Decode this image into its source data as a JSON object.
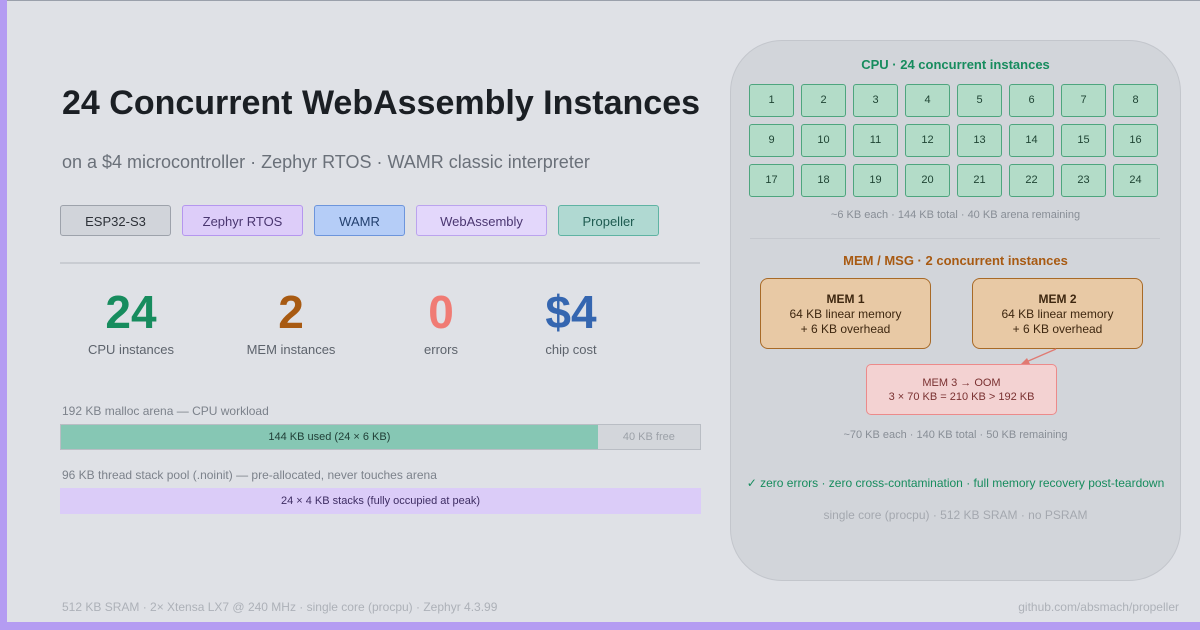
{
  "title": "24 Concurrent WebAssembly Instances",
  "subtitle": "on a $4 microcontroller · Zephyr RTOS · WAMR classic interpreter",
  "tags": [
    "ESP32-S3",
    "Zephyr RTOS",
    "WAMR",
    "WebAssembly",
    "Propeller"
  ],
  "stats": [
    {
      "value": "24",
      "label": "CPU instances",
      "color": "#178c5e"
    },
    {
      "value": "2",
      "label": "MEM instances",
      "color": "#a85a12"
    },
    {
      "value": "0",
      "label": "errors",
      "color": "#f07b74"
    },
    {
      "value": "$4",
      "label": "chip cost",
      "color": "#3566b0"
    }
  ],
  "arena": {
    "caption": "192 KB malloc arena — CPU workload",
    "used_label": "144 KB used (24 × 6 KB)",
    "free_label": "40 KB free",
    "used_fraction": 0.84
  },
  "stack_pool": {
    "caption": "96 KB thread stack pool (.noinit) — pre-allocated, never touches arena",
    "label": "24 × 4 KB stacks (fully occupied at peak)"
  },
  "footer": {
    "left": "512 KB SRAM · 2× Xtensa LX7 @ 240 MHz · single core (procpu) · Zephyr 4.3.99",
    "right": "github.com/absmach/propeller"
  },
  "panel": {
    "cpu_heading": "CPU · 24 concurrent instances",
    "cpu_cells": [
      "1",
      "2",
      "3",
      "4",
      "5",
      "6",
      "7",
      "8",
      "9",
      "10",
      "11",
      "12",
      "13",
      "14",
      "15",
      "16",
      "17",
      "18",
      "19",
      "20",
      "21",
      "22",
      "23",
      "24"
    ],
    "cpu_note": "~6 KB each · 144 KB total · 40 KB arena remaining",
    "mem_heading": "MEM / MSG · 2 concurrent instances",
    "mem1": {
      "title": "MEM 1",
      "line1": "64 KB linear memory",
      "line2": "+ 6 KB overhead"
    },
    "mem2": {
      "title": "MEM 2",
      "line1": "64 KB linear memory",
      "line2": "+ 6 KB overhead"
    },
    "oom": {
      "line1": "MEM 3 → OOM",
      "line2": "3 × 70 KB = 210 KB > 192 KB"
    },
    "mem_note": "~70 KB each · 140 KB total · 50 KB remaining",
    "success": "✓ zero errors · zero cross-contamination · full memory recovery post-teardown",
    "foot": "single core (procpu) · 512 KB SRAM · no PSRAM"
  }
}
